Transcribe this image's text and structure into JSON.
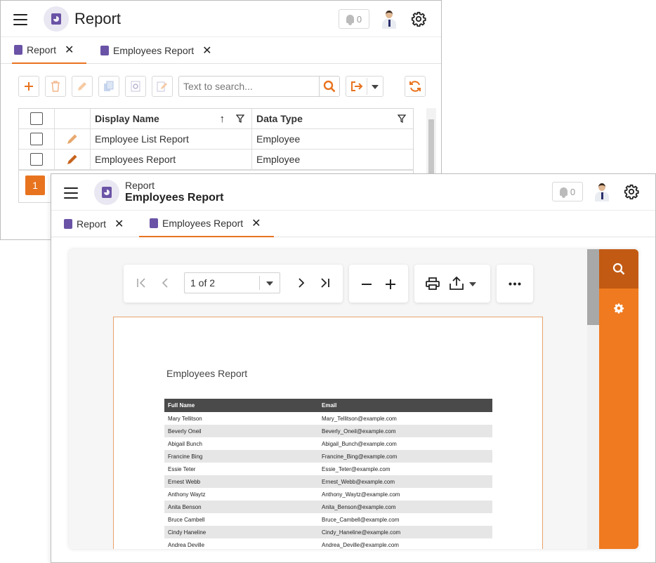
{
  "back_window": {
    "header": {
      "title": "Report",
      "notifications_count": "0"
    },
    "tabs": [
      {
        "label": "Report",
        "close": "✕"
      },
      {
        "label": "Employees Report",
        "close": "✕"
      }
    ],
    "toolbar": {
      "search_placeholder": "Text to search..."
    },
    "grid": {
      "columns": [
        "Display Name",
        "Data Type"
      ],
      "rows": [
        {
          "display_name": "Employee List Report",
          "data_type": "Employee"
        },
        {
          "display_name": "Employees Report",
          "data_type": "Employee"
        }
      ],
      "current_page": "1"
    }
  },
  "front_window": {
    "header": {
      "subtitle": "Report",
      "title": "Employees Report",
      "notifications_count": "0"
    },
    "tabs": [
      {
        "label": "Report",
        "close": "✕"
      },
      {
        "label": "Employees Report",
        "close": "✕"
      }
    ],
    "viewer": {
      "page_indicator": "1 of 2",
      "document_title": "Employees Report",
      "table_headers": [
        "Full Name",
        "Email"
      ],
      "rows": [
        {
          "name": "Mary Tellitson",
          "email": "Mary_Tellitson@example.com"
        },
        {
          "name": "Beverly Oneil",
          "email": "Beverly_Oneil@example.com"
        },
        {
          "name": "Abigail Bunch",
          "email": "Abigail_Bunch@example.com"
        },
        {
          "name": "Francine Bing",
          "email": "Francine_Bing@example.com"
        },
        {
          "name": "Essie Teter",
          "email": "Essie_Teter@example.com"
        },
        {
          "name": "Ernest Webb",
          "email": "Ernest_Webb@example.com"
        },
        {
          "name": "Anthony Waytz",
          "email": "Anthony_Waytz@example.com"
        },
        {
          "name": "Anita Benson",
          "email": "Anita_Benson@example.com"
        },
        {
          "name": "Bruce Cambell",
          "email": "Bruce_Cambell@example.com"
        },
        {
          "name": "Cindy Haneline",
          "email": "Cindy_Haneline@example.com"
        },
        {
          "name": "Andrea Deville",
          "email": "Andrea_Deville@example.com"
        }
      ]
    }
  },
  "colors": {
    "accent": "#e8731f",
    "accent_dark": "#c25a14",
    "brand_icon": "#6a53a6"
  }
}
